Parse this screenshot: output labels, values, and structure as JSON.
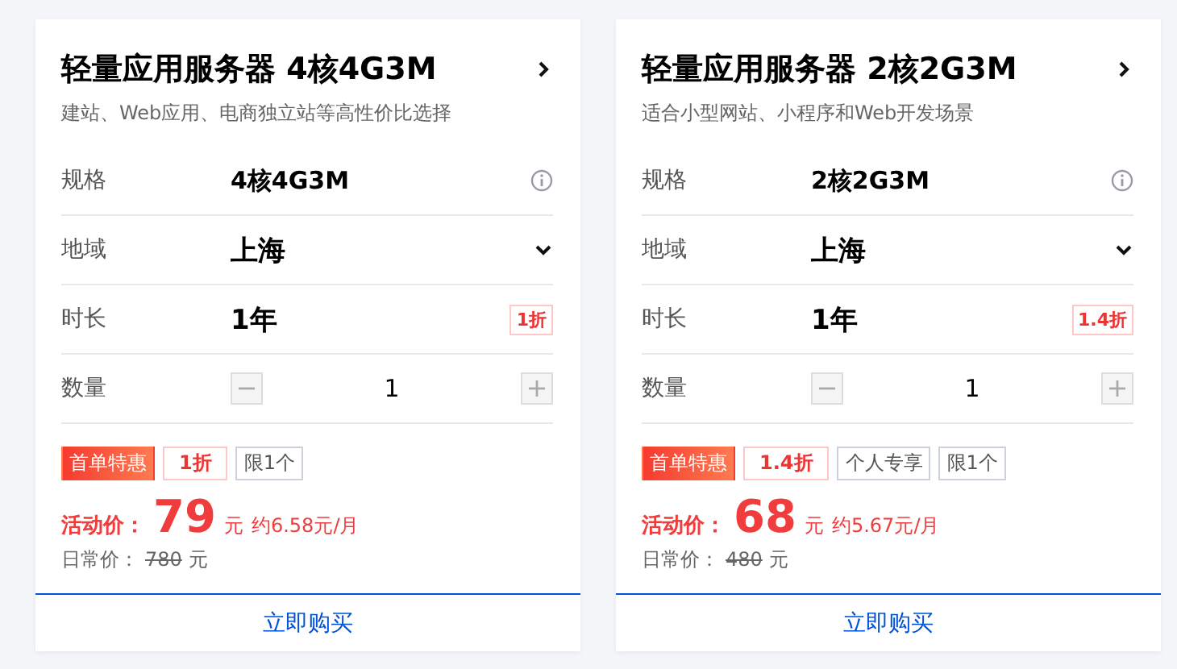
{
  "cards": [
    {
      "title": "轻量应用服务器 4核4G3M",
      "subtitle": "建站、Web应用、电商独立站等高性价比选择",
      "rows": [
        {
          "kind": "info",
          "label": "规格",
          "value": "4核4G3M"
        },
        {
          "kind": "select",
          "label": "地域",
          "value": "上海"
        },
        {
          "kind": "discount",
          "label": "时长",
          "value": "1年",
          "badge": "1折"
        },
        {
          "kind": "stepper",
          "label": "数量",
          "value": "1"
        }
      ],
      "tags": [
        {
          "kind": "promo",
          "text": "首单特惠"
        },
        {
          "kind": "discount",
          "text": "1折"
        },
        {
          "kind": "plain",
          "text": "限1个"
        }
      ],
      "price_label": "活动价：",
      "price": "79",
      "price_unit": "元",
      "monthly": "约6.58元/月",
      "regular_label": "日常价：",
      "regular_price": "780",
      "regular_unit": "元",
      "buy": "立即购买"
    },
    {
      "title": "轻量应用服务器 2核2G3M",
      "subtitle": "适合小型网站、小程序和Web开发场景",
      "rows": [
        {
          "kind": "info",
          "label": "规格",
          "value": "2核2G3M"
        },
        {
          "kind": "select",
          "label": "地域",
          "value": "上海"
        },
        {
          "kind": "discount",
          "label": "时长",
          "value": "1年",
          "badge": "1.4折"
        },
        {
          "kind": "stepper",
          "label": "数量",
          "value": "1"
        }
      ],
      "tags": [
        {
          "kind": "promo",
          "text": "首单特惠"
        },
        {
          "kind": "discount",
          "text": "1.4折"
        },
        {
          "kind": "plain",
          "text": "个人专享"
        },
        {
          "kind": "plain",
          "text": "限1个"
        }
      ],
      "price_label": "活动价：",
      "price": "68",
      "price_unit": "元",
      "monthly": "约5.67元/月",
      "regular_label": "日常价：",
      "regular_price": "480",
      "regular_unit": "元",
      "buy": "立即购买"
    }
  ]
}
